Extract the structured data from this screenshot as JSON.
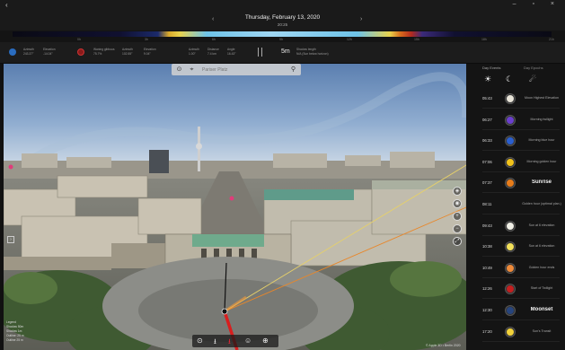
{
  "window": {
    "back_glyph": "‹",
    "controls_glyphs": "–  ▫  ×"
  },
  "header": {
    "date": "Thursday, February 13, 2020",
    "time": "20:25",
    "prev_glyph": "‹",
    "next_glyph": "›"
  },
  "timeline": {
    "ticks": [
      "0h",
      "3h",
      "6h",
      "9h",
      "12h",
      "15h",
      "18h",
      "21h"
    ]
  },
  "infobar": {
    "sun": {
      "color": "#2a6cbf",
      "azimuth_label": "Azimuth",
      "azimuth": "243.37°",
      "elevation_label": "Elevation",
      "elevation": "-14.04°"
    },
    "moon": {
      "color": "#8a1a1a",
      "label": "Waning gibbous",
      "fraction": "75.7%",
      "azimuth_label": "Azimuth",
      "azimuth": "102.55°",
      "elevation_label": "Elevation",
      "elevation": "9.04°"
    },
    "mid": {
      "azimuth_label": "Azimuth",
      "azimuth": "1.00°",
      "distance_label": "Distance",
      "distance": "7.4 km",
      "angle_label": "Angle",
      "angle": "16.43°"
    },
    "shadow": {
      "value": "5m",
      "label": "Shadow length",
      "detail": "N/A (Sun below horizon)"
    }
  },
  "search": {
    "placeholder": "Pariser Platz",
    "target_icon": "crosshair-icon",
    "location_icon": "gps-icon",
    "search_icon": "search-icon"
  },
  "panel": {
    "tabs": [
      "Day Events",
      "Day Epochs"
    ],
    "icons": [
      "sun-icon",
      "moon-icon",
      "comet-icon"
    ],
    "events": [
      {
        "time": "05:43",
        "color": "#e8e4d8",
        "label": "Moon Highest Elevation",
        "bold": false
      },
      {
        "time": "06:27",
        "color": "#6b3fcf",
        "label": "Morning twilight",
        "bold": false
      },
      {
        "time": "06:33",
        "color": "#2b5fd0",
        "label": "Morning blue hour",
        "bold": false
      },
      {
        "time": "07:06",
        "color": "#f2c31a",
        "label": "Morning golden hour",
        "bold": false
      },
      {
        "time": "07:37",
        "color": "#e87d1a",
        "label": "Sunrise",
        "bold": true
      },
      {
        "time": "08:11",
        "color": "",
        "label": "Golden hour (optimal plan.)",
        "bold": false
      },
      {
        "time": "09:43",
        "color": "#f0efe6",
        "label": "Sun at 6 elevation",
        "bold": false
      },
      {
        "time": "10:38",
        "color": "#f2e05a",
        "label": "Sun at 6 elevation",
        "bold": false
      },
      {
        "time": "10:49",
        "color": "#ee8a3a",
        "label": "Golden hour ends",
        "bold": false
      },
      {
        "time": "12:26",
        "color": "#c41f1f",
        "label": "Start of Twilight",
        "bold": false
      },
      {
        "time": "12:30",
        "color": "#27457e",
        "label": "Moonset",
        "bold": true
      },
      {
        "time": "17:20",
        "color": "#f2d23a",
        "label": "Sun’s Transit",
        "bold": false
      }
    ]
  },
  "bottom_tools": [
    "⊙",
    "⭳",
    "⭳",
    "☺",
    "⊕"
  ],
  "legend": [
    "Legend",
    "Shadow 50m",
    "Shadow 1m",
    "Outline: 25 m",
    "Outline 25 m"
  ],
  "attribution": "© Apple 3D • Berlin 2020",
  "left_toggle": "›"
}
